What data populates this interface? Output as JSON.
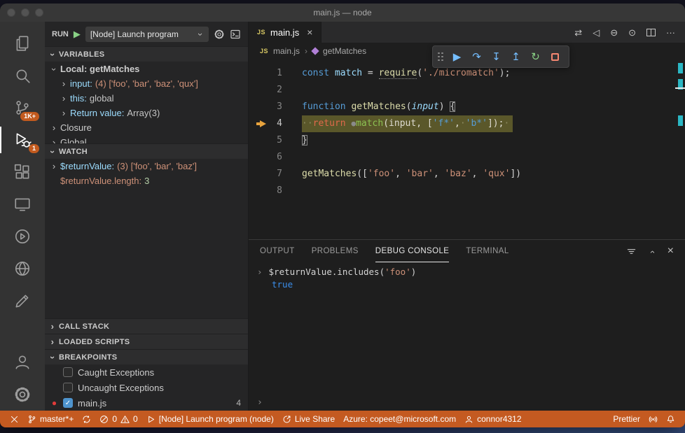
{
  "window": {
    "title": "main.js — node"
  },
  "glyphs": {
    "chevron": "›",
    "close": "×",
    "more": "···",
    "compare": "⇄",
    "prev": "◁",
    "dash_circle": "⊖",
    "dot_circle": "⊙",
    "run": "▶",
    "step_over": "↷",
    "step_into": "↧",
    "step_out": "↥",
    "restart": "↻",
    "breakpoint": "●",
    "check": "✓",
    "console_arrow": "›",
    "js_badge": "JS"
  },
  "activity_bar": {
    "scm_badge": "1K+",
    "debug_badge": "1"
  },
  "sidebar": {
    "run_label": "RUN",
    "launch_config": "[Node] Launch program",
    "sections": {
      "variables": "VARIABLES",
      "watch": "WATCH",
      "call_stack": "CALL STACK",
      "loaded_scripts": "LOADED SCRIPTS",
      "breakpoints": "BREAKPOINTS"
    },
    "variables": [
      {
        "indent": 1,
        "chevron": "down",
        "label": "Local: getMatches",
        "bold": true
      },
      {
        "indent": 2,
        "chevron": "right",
        "name": "input:",
        "value": "(4) ['foo', 'bar', 'baz', 'qux']",
        "value_style": "string"
      },
      {
        "indent": 2,
        "chevron": "right",
        "name": "this:",
        "value": "global",
        "value_style": "plain"
      },
      {
        "indent": 2,
        "chevron": "right",
        "name": "Return value:",
        "value": "Array(3)",
        "value_style": "plain"
      },
      {
        "indent": 1,
        "chevron": "right",
        "label": "Closure"
      },
      {
        "indent": 1,
        "chevron": "right",
        "label": "Global"
      }
    ],
    "watch": [
      {
        "indent": 1,
        "chevron": "right",
        "name": "$returnValue:",
        "name_style": "plain",
        "value": "(3) ['foo', 'bar', 'baz']",
        "value_style": "string"
      },
      {
        "indent": 1,
        "chevron": "none",
        "name": "$returnValue.length:",
        "name_style": "orange",
        "value": "3",
        "value_style": "number"
      }
    ],
    "breakpoints": [
      {
        "checked": false,
        "dot": false,
        "label": "Caught Exceptions",
        "count": ""
      },
      {
        "checked": false,
        "dot": false,
        "label": "Uncaught Exceptions",
        "count": ""
      },
      {
        "checked": true,
        "dot": true,
        "label": "main.js",
        "count": "4"
      }
    ]
  },
  "editor": {
    "tab": {
      "icon_text": "JS",
      "label": "main.js"
    },
    "breadcrumb": {
      "file_icon_text": "JS",
      "file": "main.js",
      "symbol": "getMatches"
    },
    "code_lines": [
      {
        "num": "1",
        "tokens": [
          [
            "const ",
            "kw"
          ],
          [
            "match",
            "vbl"
          ],
          [
            " = ",
            "pun"
          ],
          [
            "require",
            "fn u"
          ],
          [
            "(",
            "pun"
          ],
          [
            "'./micromatch'",
            "str"
          ],
          [
            ");",
            "pun"
          ]
        ]
      },
      {
        "num": "2",
        "tokens": []
      },
      {
        "num": "3",
        "tokens": [
          [
            "function ",
            "kw"
          ],
          [
            "getMatches",
            "fn"
          ],
          [
            "(",
            "pun"
          ],
          [
            "input",
            "param"
          ],
          [
            ") ",
            "pun"
          ],
          [
            "{",
            "pun brk"
          ]
        ]
      },
      {
        "num": "4",
        "arrow": true,
        "highlight": true,
        "tokens": [
          [
            "··",
            "ws"
          ],
          [
            "return ",
            "ret"
          ],
          [
            "●",
            "ibp"
          ],
          [
            "match",
            "grn"
          ],
          [
            "(",
            "l4p"
          ],
          [
            "input",
            "l4p"
          ],
          [
            ", [",
            "l4p"
          ],
          [
            "'f*'",
            "blu"
          ],
          [
            ",",
            "l4p"
          ],
          [
            "·",
            "ws"
          ],
          [
            "'b*'",
            "blu"
          ],
          [
            "]);",
            "l4p"
          ],
          [
            "·",
            "ws"
          ]
        ]
      },
      {
        "num": "5",
        "tokens": [
          [
            "}",
            "pun brk"
          ]
        ]
      },
      {
        "num": "6",
        "tokens": []
      },
      {
        "num": "7",
        "tokens": [
          [
            "getMatches",
            "fn"
          ],
          [
            "([",
            "pun"
          ],
          [
            "'foo'",
            "str"
          ],
          [
            ", ",
            "pun"
          ],
          [
            "'bar'",
            "str"
          ],
          [
            ", ",
            "pun"
          ],
          [
            "'baz'",
            "str"
          ],
          [
            ", ",
            "pun"
          ],
          [
            "'qux'",
            "str"
          ],
          [
            "])",
            "pun"
          ]
        ]
      },
      {
        "num": "8",
        "tokens": []
      }
    ]
  },
  "panel": {
    "tabs": [
      {
        "label": "OUTPUT",
        "active": false
      },
      {
        "label": "PROBLEMS",
        "active": false
      },
      {
        "label": "DEBUG CONSOLE",
        "active": true
      },
      {
        "label": "TERMINAL",
        "active": false
      }
    ],
    "console": {
      "entries": [
        {
          "kind": "input",
          "tokens": [
            [
              "$returnValue.includes(",
              "pun"
            ],
            [
              "'foo'",
              "str"
            ],
            [
              ")",
              "pun"
            ]
          ]
        },
        {
          "kind": "result",
          "text": "true"
        }
      ]
    }
  },
  "status_bar": {
    "branch": "master*+",
    "errors": "0",
    "warnings": "0",
    "debug_target": "[Node] Launch program (node)",
    "live_share": "Live Share",
    "azure": "Azure: copeet@microsoft.com",
    "account": "connor4312",
    "formatter": "Prettier"
  },
  "colors": {
    "statusbar_debugging": "#c45a21",
    "badge": "#c25a1e",
    "debug_line_highlight": "#5a572a",
    "breakpoint_red": "#e13b3a",
    "accent_blue": "#75beff"
  }
}
